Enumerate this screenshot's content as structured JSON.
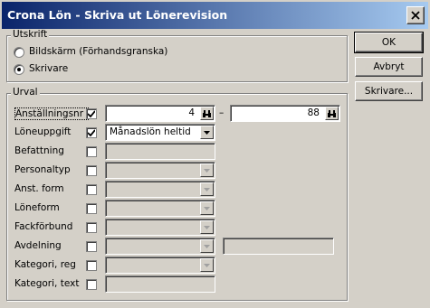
{
  "window": {
    "title": "Crona Lön - Skriva ut Lönerevision"
  },
  "utskrift": {
    "legend": "Utskrift",
    "options": [
      {
        "label": "Bildskärm (Förhandsgranska)",
        "selected": false
      },
      {
        "label": "Skrivare",
        "selected": true
      }
    ]
  },
  "buttons": {
    "ok": "OK",
    "cancel": "Avbryt",
    "printer": "Skrivare..."
  },
  "urval": {
    "legend": "Urval",
    "rows": [
      {
        "label": "Anställningsnr",
        "checked": true,
        "from": "4",
        "to": "88"
      },
      {
        "label": "Löneuppgift",
        "checked": true,
        "value": "Månadslön heltid"
      },
      {
        "label": "Befattning",
        "checked": false
      },
      {
        "label": "Personaltyp",
        "checked": false,
        "value": ""
      },
      {
        "label": "Anst. form",
        "checked": false,
        "value": ""
      },
      {
        "label": "Löneform",
        "checked": false,
        "value": ""
      },
      {
        "label": "Fackförbund",
        "checked": false,
        "value": ""
      },
      {
        "label": "Avdelning",
        "checked": false,
        "value": ""
      },
      {
        "label": "Kategori, reg",
        "checked": false,
        "value": ""
      },
      {
        "label": "Kategori, text",
        "checked": false
      }
    ],
    "range_separator": "–"
  }
}
